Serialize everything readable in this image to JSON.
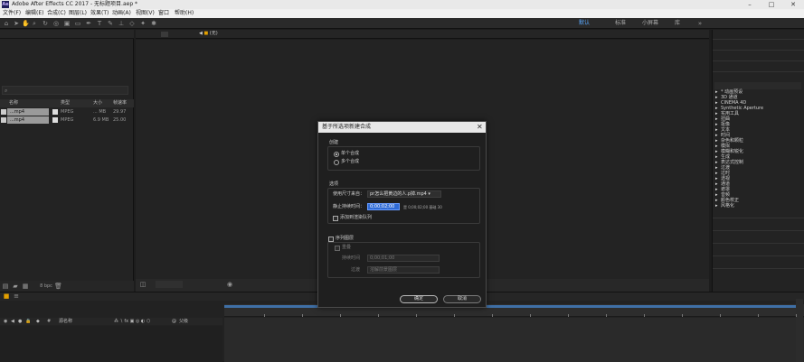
{
  "window": {
    "title": "Adobe After Effects CC 2017 - 无标题项目.aep *",
    "logo": "Ae"
  },
  "menubar": {
    "items": [
      "文件(F)",
      "编辑(E)",
      "合成(C)",
      "图层(L)",
      "效果(T)",
      "动画(A)",
      "视图(V)",
      "窗口",
      "帮助(H)"
    ]
  },
  "toolbar": {
    "workspaces": [
      "默认",
      "标准",
      "小屏幕",
      "库"
    ],
    "active_workspace": "默认"
  },
  "project": {
    "columns": [
      "名称",
      "类型",
      "大小",
      "帧速率"
    ],
    "files": [
      {
        "name": "...mp4",
        "type": "MPEG",
        "size": "... MB",
        "fps": "29.97"
      },
      {
        "name": "...mp4",
        "type": "MPEG",
        "size": "6.9 MB",
        "fps": "25.00"
      }
    ],
    "bpc": "8 bpc"
  },
  "composition": {
    "tab_label": "(无)"
  },
  "effects": {
    "items": [
      "* 动画预设",
      "3D 通道",
      "CINEMA 4D",
      "Synthetic Aperture",
      "实用工具",
      "扭曲",
      "抠像",
      "文本",
      "时间",
      "杂色和颗粒",
      "模拟",
      "模糊和锐化",
      "生成",
      "表达式控制",
      "过渡",
      "过时",
      "透视",
      "通道",
      "遮罩",
      "音频",
      "颜色校正",
      "风格化"
    ]
  },
  "timeline": {
    "columns": [
      "源名称",
      "父级"
    ]
  },
  "dialog": {
    "title": "基于所选项新建合成",
    "create_group": "创建",
    "option_single": "单个合成",
    "option_multiple": "多个合成",
    "options_group": "选项",
    "use_dims_label": "使用尺寸来自：",
    "use_dims_value": "pr怎么把黄边的人.p掉.mp4",
    "still_duration_label": "静止持续时间：",
    "still_duration_value": "0;00;02;00",
    "still_duration_hint": "是 0;00;02;00 基础 30",
    "add_to_render_queue": "添加到渲染队列",
    "sequence_layers": "序列图层",
    "overlap": "重叠",
    "duration_label": "持续时间",
    "duration_value": "0;00;01;00",
    "transition_label": "过渡",
    "transition_value": "溶解前景图层",
    "ok": "确定",
    "cancel": "取消"
  }
}
